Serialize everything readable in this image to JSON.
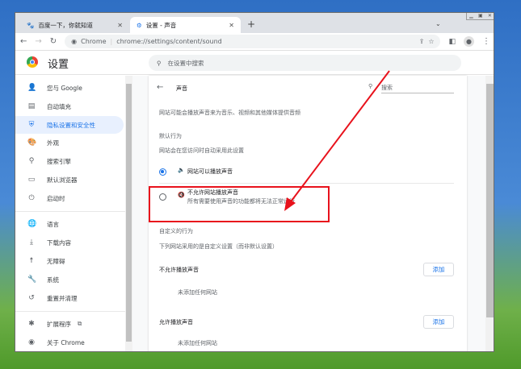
{
  "tabs": [
    {
      "label": "百度一下，你就知道",
      "active": false
    },
    {
      "label": "设置 - 声音",
      "active": true
    }
  ],
  "toolbar": {
    "site_label": "Chrome",
    "url": "chrome://settings/content/sound"
  },
  "header": {
    "title": "设置",
    "search_placeholder": "在设置中搜索"
  },
  "sidebar": {
    "items": [
      {
        "label": "您与 Google",
        "icon": "person-icon"
      },
      {
        "label": "自动填充",
        "icon": "clipboard-icon"
      },
      {
        "label": "隐私设置和安全性",
        "icon": "shield-icon",
        "selected": true
      },
      {
        "label": "外观",
        "icon": "palette-icon"
      },
      {
        "label": "搜索引擎",
        "icon": "search-icon"
      },
      {
        "label": "默认浏览器",
        "icon": "browser-icon"
      },
      {
        "label": "启动时",
        "icon": "power-icon"
      },
      {
        "label": "语言",
        "icon": "globe-icon"
      },
      {
        "label": "下载内容",
        "icon": "download-icon"
      },
      {
        "label": "无障碍",
        "icon": "accessibility-icon"
      },
      {
        "label": "系统",
        "icon": "wrench-icon"
      },
      {
        "label": "重置并清理",
        "icon": "history-icon"
      },
      {
        "label": "扩展程序",
        "icon": "puzzle-icon"
      },
      {
        "label": "关于 Chrome",
        "icon": "chrome-icon"
      }
    ]
  },
  "page": {
    "title": "声音",
    "search_placeholder": "搜索",
    "description": "网站可能会播放声音来为音乐、视频和其他媒体提供音频",
    "default_heading": "默认行为",
    "default_sub": "网站会在您访问时自动采用此设置",
    "option_allow": "网站可以播放声音",
    "option_block": "不允许网站播放声音",
    "option_block_sub": "所有需要使用声音的功能都将无法正常运行",
    "custom_heading": "自定义的行为",
    "custom_sub": "下列网站采用的是自定义设置（而非默认设置）",
    "block_list": "不允许播放声音",
    "allow_list": "允许播放声音",
    "add": "添加",
    "empty": "未添加任何网站"
  },
  "colors": {
    "accent": "#1a73e8",
    "annotation": "#e8121c"
  }
}
